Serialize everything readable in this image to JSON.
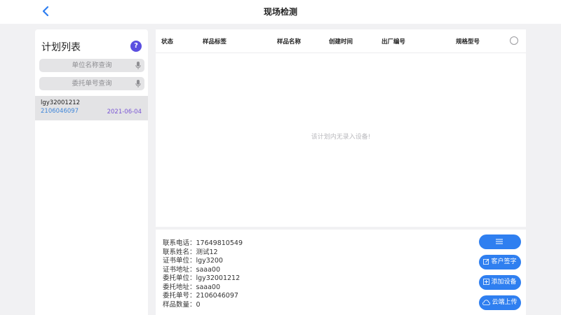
{
  "header": {
    "title": "现场检测"
  },
  "sidebar": {
    "title": "计划列表",
    "help_icon_glyph": "?",
    "search_unit_placeholder": "单位名称查询",
    "search_order_placeholder": "委托单号查询",
    "items": [
      {
        "code": "lgy32001212",
        "number": "2106046097",
        "date": "2021-06-04"
      }
    ]
  },
  "table": {
    "columns": [
      "状态",
      "样品标签",
      "样品名称",
      "创建时间",
      "出厂编号",
      "规格型号"
    ],
    "empty_message": "该计划内无录入设备!"
  },
  "info": {
    "lines": [
      "联系电话：17649810549",
      "联系姓名：测试12",
      "证书单位：lgy3200",
      "证书地址：saaa00",
      "委托单位：lgy32001212",
      "委托地址：saaa00",
      "委托单号：2106046097",
      "样品数量：0"
    ]
  },
  "actions": {
    "menu_icon": "menu-icon",
    "sign_label": "客户签字",
    "add_device_label": "添加设备",
    "upload_label": "云端上传"
  },
  "colors": {
    "accent": "#2f7ff0",
    "help": "#5b4fe0",
    "plan_number": "#3f86d9",
    "plan_date": "#7a56d4"
  }
}
